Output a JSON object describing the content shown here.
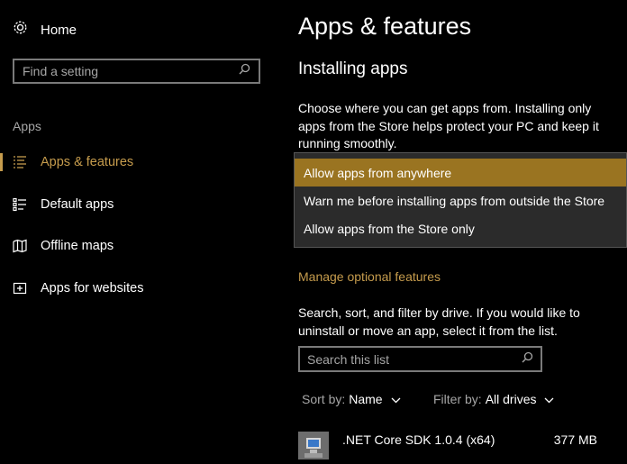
{
  "sidebar": {
    "home_label": "Home",
    "search_placeholder": "Find a setting",
    "section_header": "Apps",
    "items": [
      {
        "label": "Apps & features",
        "icon": "list-icon",
        "selected": true
      },
      {
        "label": "Default apps",
        "icon": "default-apps-icon",
        "selected": false
      },
      {
        "label": "Offline maps",
        "icon": "map-icon",
        "selected": false
      },
      {
        "label": "Apps for websites",
        "icon": "websites-icon",
        "selected": false
      }
    ]
  },
  "main": {
    "title": "Apps & features",
    "section_title": "Installing apps",
    "description": "Choose where you can get apps from. Installing only apps from the Store helps protect your PC and keep it running smoothly.",
    "dropdown_options": [
      "Allow apps from anywhere",
      "Warn me before installing apps from outside the Store",
      "Allow apps from the Store only"
    ],
    "manage_link": "Manage optional features",
    "search_description": "Search, sort, and filter by drive. If you would like to uninstall or move an app, select it from the list.",
    "list_search_placeholder": "Search this list",
    "sort_label": "Sort by:",
    "sort_value": "Name",
    "filter_label": "Filter by:",
    "filter_value": "All drives",
    "apps": [
      {
        "name": ".NET Core SDK 1.0.4 (x64)",
        "size": "377 MB"
      }
    ]
  },
  "colors": {
    "accent": "#c69c4d",
    "highlight": "#9a7421",
    "background": "#000000",
    "dropdown_bg": "#2b2b2b"
  }
}
